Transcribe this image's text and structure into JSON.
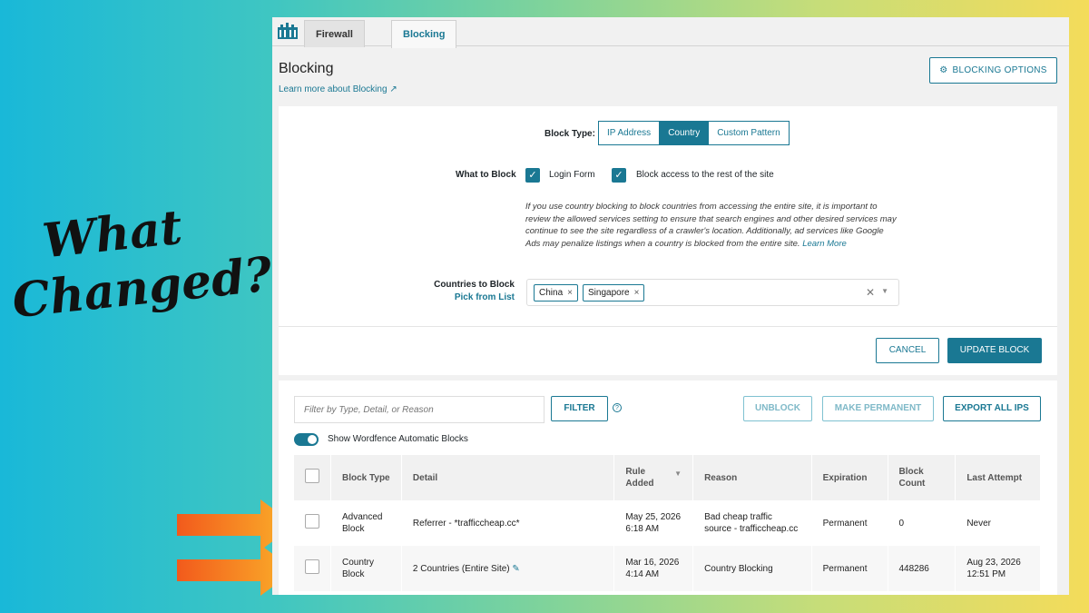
{
  "headline": {
    "line1": "What",
    "line2": "Changed?"
  },
  "tabs": [
    {
      "label": "Firewall"
    },
    {
      "label": "Blocking"
    }
  ],
  "page": {
    "title": "Blocking",
    "learn_more": "Learn more about Blocking",
    "options_button": "BLOCKING OPTIONS"
  },
  "form": {
    "block_type_label": "Block Type:",
    "block_types": [
      "IP Address",
      "Country",
      "Custom Pattern"
    ],
    "selected_block_type": "Country",
    "what_to_block_label": "What to Block",
    "options": [
      "Login Form",
      "Block access to the rest of the site"
    ],
    "note": "If you use country blocking to block countries from accessing the entire site, it is important to review the allowed services setting to ensure that search engines and other desired services may continue to see the site regardless of a crawler's location. Additionally, ad services like Google Ads may penalize listings when a country is blocked from the entire site.",
    "note_link": "Learn More",
    "countries_label": "Countries to Block",
    "pick_from_list": "Pick from List",
    "countries": [
      "China",
      "Singapore"
    ],
    "cancel": "CANCEL",
    "update": "UPDATE BLOCK"
  },
  "list": {
    "filter_placeholder": "Filter by Type, Detail, or Reason",
    "filter_button": "FILTER",
    "unblock": "UNBLOCK",
    "make_permanent": "MAKE PERMANENT",
    "export": "EXPORT ALL IPS",
    "toggle_label": "Show Wordfence Automatic Blocks",
    "columns": [
      "Block Type",
      "Detail",
      "Rule Added",
      "Reason",
      "Expiration",
      "Block Count",
      "Last Attempt"
    ],
    "rows": [
      {
        "type": "Advanced Block",
        "detail": "Referrer - *trafficcheap.cc*",
        "added": "May 25, 2026 6:18 AM",
        "reason": "Bad cheap traffic source - trafficcheap.cc",
        "expiration": "Permanent",
        "count": "0",
        "last": "Never"
      },
      {
        "type": "Country Block",
        "detail": "2 Countries (Entire Site)",
        "added": "Mar 16, 2026 4:14 AM",
        "reason": "Country Blocking",
        "expiration": "Permanent",
        "count": "448286",
        "last": "Aug 23, 2026 12:51 PM"
      }
    ]
  },
  "colors": {
    "accent": "#1a7893",
    "arrow": "#f7941d"
  }
}
